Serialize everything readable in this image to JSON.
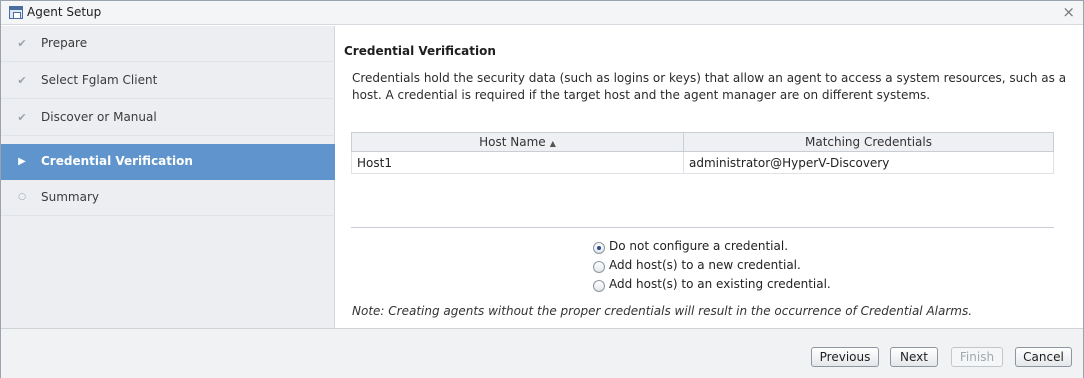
{
  "window": {
    "title": "Agent Setup",
    "close_glyph": "×"
  },
  "steps": [
    {
      "label": "Prepare",
      "status": "done",
      "icon": "check-icon",
      "glyph": "✔"
    },
    {
      "label": "Select Fglam Client",
      "status": "done",
      "icon": "check-icon",
      "glyph": "✔"
    },
    {
      "label": "Discover or Manual",
      "status": "done",
      "icon": "check-icon",
      "glyph": "✔"
    },
    {
      "label": "Credential Verification",
      "status": "active",
      "icon": "play-icon",
      "glyph": "▶"
    },
    {
      "label": "Summary",
      "status": "pending",
      "icon": "circle-icon",
      "glyph": "○"
    }
  ],
  "main": {
    "heading": "Credential Verification",
    "description": "Credentials hold the security data (such as logins or keys) that allow an agent to access a system resources, such as a host. A credential is required if the target host and the agent manager are on different systems.",
    "table": {
      "columns": [
        "Host Name",
        "Matching Credentials"
      ],
      "sort_glyph": "▲",
      "rows": [
        {
          "host": "Host1",
          "credential": "administrator@HyperV-Discovery"
        }
      ]
    },
    "options": [
      {
        "label": "Do not configure a credential.",
        "selected": true
      },
      {
        "label": "Add host(s) to a new credential.",
        "selected": false
      },
      {
        "label": "Add host(s) to an existing credential.",
        "selected": false
      }
    ],
    "note": "Note: Creating agents without the proper credentials will result in the occurrence of Credential Alarms."
  },
  "footer": {
    "previous": "Previous",
    "next": "Next",
    "finish": "Finish",
    "cancel": "Cancel"
  },
  "colors": {
    "active_step": "#5f95cc",
    "sidebar_bg": "#eceef1",
    "accent": "#2b4f86"
  }
}
